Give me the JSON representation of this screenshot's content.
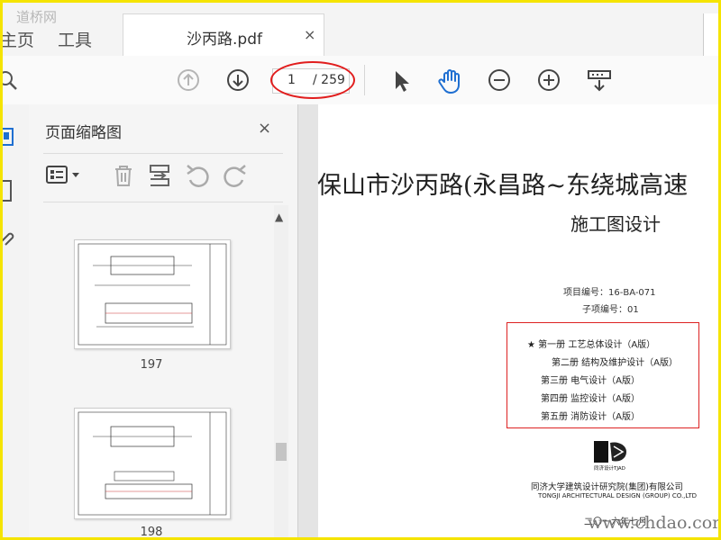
{
  "watermark_top": "道桥网",
  "watermark_bottom": "www.chdao.com",
  "tabs": {
    "home": "主页",
    "tools": "工具",
    "document": "沙丙路.pdf",
    "close": "×"
  },
  "toolbar": {
    "page_current": "1",
    "page_total": "/ 259"
  },
  "panel": {
    "title": "页面缩略图",
    "close": "×",
    "thumbnails": [
      {
        "label": "197"
      },
      {
        "label": "198"
      }
    ]
  },
  "document": {
    "title": "保山市沙丙路(永昌路~东绕城高速",
    "subtitle": "施工图设计",
    "project_no": "项目编号：16-BA-071",
    "sub_no": "子项编号：01",
    "volumes": [
      "★ 第一册   工艺总体设计（A版）",
      "第二册   结构及维护设计（A版）",
      "第三册   电气设计（A版）",
      "第四册   监控设计（A版）",
      "第五册   消防设计（A版）"
    ],
    "logo_caption": "同济设计TJAD",
    "org_cn": "同济大学建筑设计研究院(集团)有限公司",
    "org_en": "TONGJI ARCHITECTURAL DESIGN (GROUP) CO.,LTD",
    "date": "二〇一六年七月"
  },
  "colors": {
    "highlight": "#e11d1d",
    "frame": "#f5e400",
    "hand_tool": "#1f6fd1"
  }
}
